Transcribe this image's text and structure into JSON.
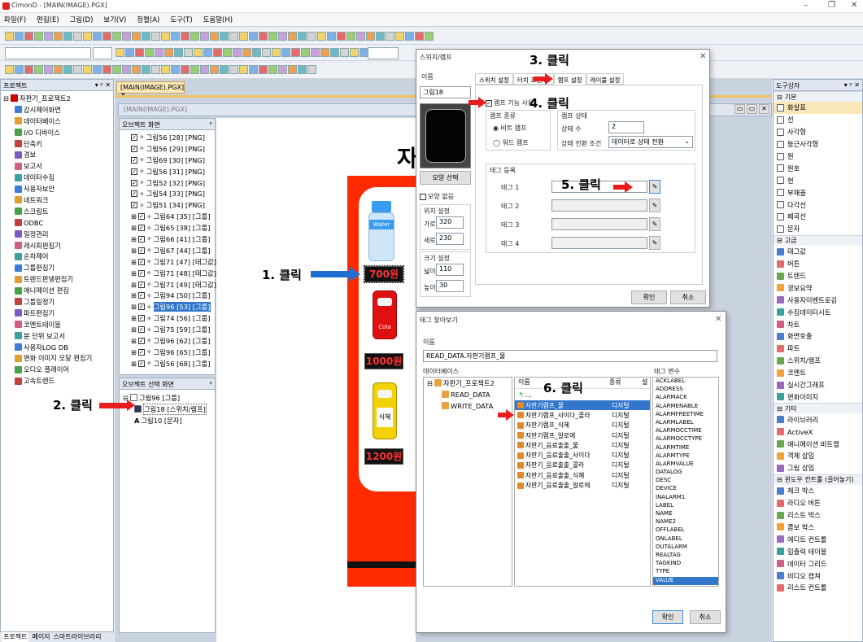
{
  "window": {
    "title": "CimonD - [MAIN(IMAGE).PGX]"
  },
  "menu": [
    "파일(F)",
    "편집(E)",
    "그림(D)",
    "보기(V)",
    "정렬(A)",
    "도구(T)",
    "도움말(H)"
  ],
  "project_panel": {
    "title": "프로젝트",
    "root": "자판기_프로젝트2",
    "items": [
      "감시제어화면",
      "데이터베이스",
      "I/O 디바이스",
      "단축키",
      "경보",
      "보고서",
      "데이터수집",
      "사용자보안",
      "네트워크",
      "스크립트",
      "ODBC",
      "일정관리",
      "레시피편집기",
      "순차제어",
      "그룹편집기",
      "트렌드판넬편집기",
      "애니메이션 편집",
      "그룹일정기",
      "파트편집기",
      "코멘트테이블",
      "분 단위 보고서",
      "사용자LOG DB",
      "변화 이미지 모달 편집기",
      "오디오 플레이어",
      "고속트렌드"
    ],
    "bottom_tabs": [
      "프로젝트",
      "페이지",
      "스마트라이브러리"
    ]
  },
  "doc_tab": {
    "label": "[MAIN(IMAGE).PGX]",
    "inner_title": "[MAIN(IMAGE).PGX]"
  },
  "object_panel": {
    "title": "오브젝트 화면",
    "items": [
      "그림56 [28] [PNG]",
      "그림56 [29] [PNG]",
      "그림69 [30] [PNG]",
      "그림56 [31] [PNG]",
      "그림52 [32] [PNG]",
      "그림54 [33] [PNG]",
      "그림51 [34] [PNG]",
      "그림64 [35] [그룹]",
      "그림65 [38] [그룹]",
      "그림66 [41] [그룹]",
      "그림67 [44] [그룹]",
      "그림71 [47] [태그값]",
      "그림71 [48] [태그값]",
      "그림71 [49] [태그값]",
      "그림94 [50] [그룹]",
      "그림96 [53] [그룹]",
      "그림74 [56] [그룹]",
      "그림75 [59] [그룹]",
      "그림96 [62] [그룹]",
      "그림96 [65] [그룹]",
      "그림56 [68] [그룹]"
    ]
  },
  "select_panel": {
    "title": "오브젝트 선택 화면",
    "group": "그림96 [그룹]",
    "child1": "그림18 [스위치/램프]",
    "child2": "그림10 [문자]"
  },
  "canvas": {
    "title_char": "자",
    "price1": "700원",
    "price2": "1000원",
    "price3": "1200원",
    "bottle_label": "Water",
    "can_label": "Cola",
    "can2_label": "식혜"
  },
  "switch_dialog": {
    "title": "스위치/램프",
    "name_label": "이름",
    "name_value": "그림18",
    "tabs": [
      "스위치 설정",
      "터치 조건/...",
      "램프 설정",
      "레이블 설정"
    ],
    "shape_button": "모양 선택",
    "no_shape": "모양 없음",
    "position_label": "위치 설정",
    "x_label": "가로",
    "x_value": "320",
    "y_label": "세로",
    "y_value": "230",
    "size_label": "크기 설정",
    "w_label": "넓이",
    "w_value": "110",
    "h_label": "높이",
    "h_value": "30",
    "lamp_enable": "램프 기능 사용",
    "lamp_type_label": "램프 종류",
    "bit_lamp": "비트 램프",
    "word_lamp": "워드 램프",
    "lamp_state_label": "램프 상태",
    "state_count_label": "상태 수",
    "state_count": "2",
    "state_cond_label": "상태 전환 조건",
    "state_cond_value": "데이터로 상태 전환",
    "tag_reg_label": "태그 등록",
    "tag_rows": [
      "태그 1",
      "태그 2",
      "태그 3",
      "태그 4"
    ],
    "ok": "확인",
    "cancel": "취소"
  },
  "tag_dialog": {
    "title": "태그 찾아보기",
    "name_label": "이름",
    "name_value": "READ_DATA.자판기램프_물",
    "db_label": "데이터베이스",
    "tree_root": "자판기_프로젝트2",
    "tree_children": [
      "READ_DATA",
      "WRITE_DATA"
    ],
    "col_name": "이름",
    "col_type": "종류",
    "col_desc": "설",
    "up_row": "...",
    "rows": [
      {
        "name": "자판기램프_물",
        "type": "디지털"
      },
      {
        "name": "자판기램프_사이다_콜라",
        "type": "디지털"
      },
      {
        "name": "자판기램프_식혜",
        "type": "디지털"
      },
      {
        "name": "자판기램프_알로에",
        "type": "디지털"
      },
      {
        "name": "자판기_음료출출_물",
        "type": "디지털"
      },
      {
        "name": "자판기_음료출출_사이다",
        "type": "디지털"
      },
      {
        "name": "자판기_음료출출_콜라",
        "type": "디지털"
      },
      {
        "name": "자판기_음료출출_식혜",
        "type": "디지털"
      },
      {
        "name": "자판기_음료출출_알로에",
        "type": "디지털"
      }
    ],
    "var_label": "태그 변수",
    "vars": [
      "ACKLABEL",
      "ADDRESS",
      "ALARMACK",
      "ALARMENABLE",
      "ALARMFREETIME",
      "ALARMLABEL",
      "ALARMOCCTIME",
      "ALARMOCCTYPE",
      "ALARMTIME",
      "ALARMTYPE",
      "ALARMVALUE",
      "DATALOG",
      "DESC",
      "DEVICE",
      "INALARM1",
      "LABEL",
      "NAME",
      "NAME2",
      "OFFLABEL",
      "ONLABEL",
      "OUTALARM",
      "REALTAG",
      "TAGKIND",
      "TYPE",
      "VALUE"
    ],
    "ok": "확인",
    "cancel": "취소"
  },
  "toolbox": {
    "title": "도구상자",
    "sections": [
      {
        "name": "기본",
        "items": [
          "화살표",
          "선",
          "사각형",
          "둥근사각형",
          "원",
          "원호",
          "현",
          "부채꼴",
          "다각선",
          "폐곡선",
          "문자"
        ]
      },
      {
        "name": "고급",
        "items": [
          "태그값",
          "버튼",
          "트렌드",
          "경보요약",
          "사용자이벤트로깅",
          "수집데이터시트",
          "차트",
          "화면호출",
          "파트",
          "스위치/램프",
          "코멘트",
          "실시간그래프",
          "변화이미지"
        ]
      },
      {
        "name": "기타",
        "items": [
          "라이브러리",
          "ActiveX",
          "애니메이션 비트맵",
          "객체 삽입",
          "그림 삽입"
        ]
      },
      {
        "name": "윈도우 컨트롤 (끌어놓기)",
        "items": [
          "체크 박스",
          "라디오 버튼",
          "리스트 박스",
          "콤보 박스",
          "에디트 컨트롤",
          "입출력 테이블",
          "데이터 그리드",
          "비디오 캡쳐",
          "리스트 컨트롤"
        ]
      }
    ]
  },
  "annotations": {
    "step1": "1. 클릭",
    "step2": "2. 클릭",
    "step3": "3. 클릭",
    "step4": "4. 클릭",
    "step5": "5. 클릭",
    "step6": "6. 클릭"
  }
}
